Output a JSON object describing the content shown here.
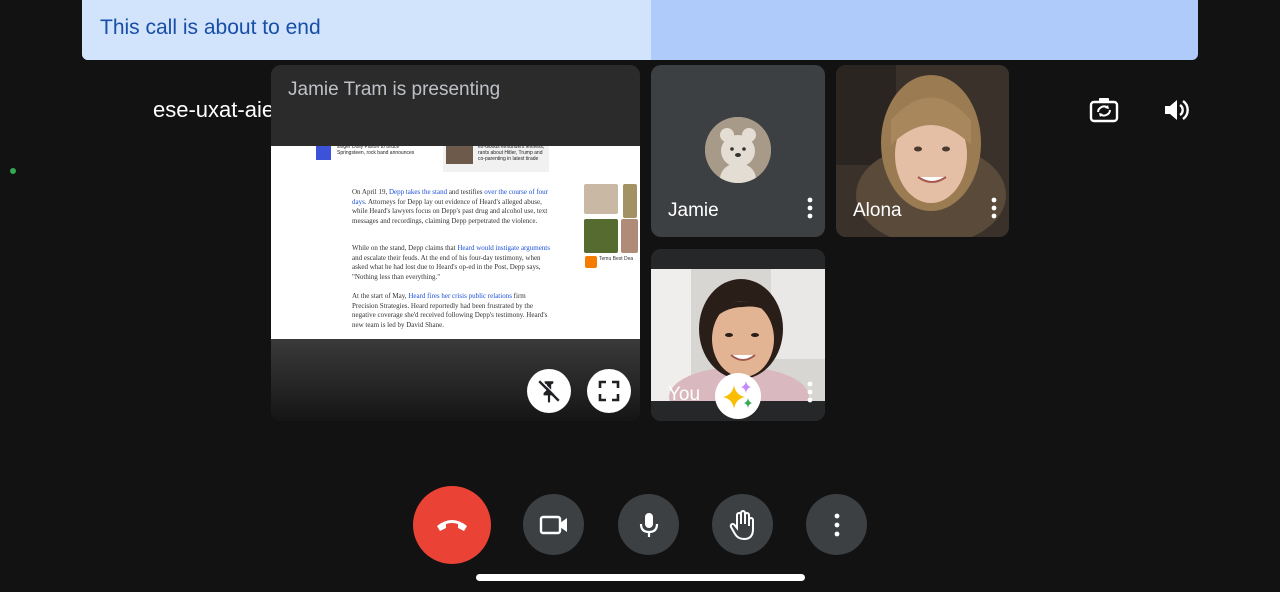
{
  "banner": {
    "text": "This call is about to end",
    "progress_fraction": 0.51
  },
  "meeting": {
    "code": "ese-uxat-aie"
  },
  "presentation": {
    "caption": "Jamie Tram is presenting",
    "article": {
      "headline_left": "singer Dolly Parton to Bruce Springsteen, rock band announces",
      "headline_right": "ex-Goods elmunders leftness, rants about Hitler, Trump and co-parenting in latest tirade",
      "p1_a": "On April 19, ",
      "p1_link1": "Depp takes the stand",
      "p1_b": " and testifies ",
      "p1_link2": "over the course of four days",
      "p1_c": ". Attorneys for Depp lay out evidence of Heard's alleged abuse, while Heard's lawyers focus on Depp's past drug and alcohol use, text messages and recordings, claiming Depp perpetrated the violence.",
      "p2_a": "While on the stand, Depp claims that ",
      "p2_link": "Heard would instigate arguments",
      "p2_b": " and escalate their feuds. At the end of his four-day testimony, when asked what he had lost due to Heard's op-ed in the Post, Depp says, \"Nothing less than everything.\"",
      "p3_a": "At the start of May, ",
      "p3_link": "Heard fires her crisis public relations",
      "p3_b": " firm Precision Strategies. Heard reportedly had been frustrated by the negative coverage she'd received following Depp's testimony. Heard's new team is led by David Shane.",
      "side_ad": "Temu Best Dea",
      "side_ad_sub": "Temu"
    }
  },
  "participants": [
    {
      "name": "Jamie"
    },
    {
      "name": "Alona"
    },
    {
      "name": "You"
    }
  ],
  "icons": {
    "unpin": "unpin-icon",
    "fullscreen": "fullscreen-icon",
    "camera_switch": "switch-camera-icon",
    "speaker": "speaker-icon",
    "effects": "sparkle-effects-icon",
    "hangup": "hang-up-icon",
    "camera": "video-camera-icon",
    "mic": "microphone-icon",
    "hand": "raise-hand-icon",
    "more": "more-vert-icon"
  },
  "colors": {
    "hangup": "#ea4335",
    "banner": "#aecbfa",
    "banner_progress": "#d2e3fc",
    "link": "#1a4fd6"
  }
}
